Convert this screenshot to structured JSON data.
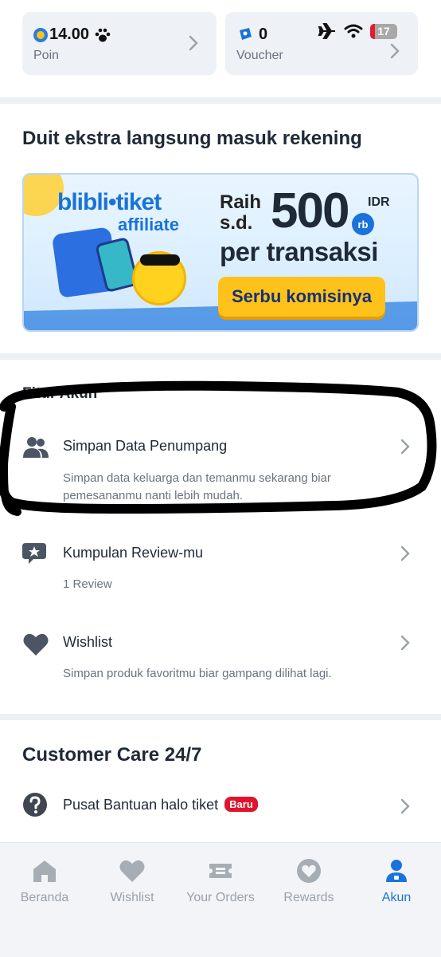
{
  "points": {
    "value": "14.00",
    "label": "Poin"
  },
  "voucher": {
    "value": "0",
    "label": "Voucher"
  },
  "status_bar": {
    "battery": "17",
    "icons": [
      "paw-icon",
      "airplane-icon",
      "wifi-icon",
      "battery-icon"
    ]
  },
  "affiliate": {
    "title": "Duit ekstra langsung masuk rekening",
    "banner": {
      "brand": "blibli•tiket",
      "sub": "affiliate",
      "raih": "Raih",
      "sd": "s.d.",
      "amount": "500",
      "currency": "IDR",
      "unit": "rb",
      "per": "per transaksi",
      "cta": "Serbu komisinya"
    }
  },
  "fitur": {
    "title": "Fitur Akun",
    "items": [
      {
        "title": "Simpan Data Penumpang",
        "desc": "Simpan data keluarga dan temanmu sekarang biar pemesananmu nanti lebih mudah.",
        "icon": "people-icon"
      },
      {
        "title": "Kumpulan Review-mu",
        "desc": "1 Review",
        "icon": "review-icon"
      },
      {
        "title": "Wishlist",
        "desc": "Simpan produk favoritmu biar gampang dilihat lagi.",
        "icon": "heart-icon"
      }
    ]
  },
  "customer_care": {
    "title": "Customer Care 24/7",
    "item": {
      "title": "Pusat Bantuan halo tiket",
      "badge": "Baru",
      "icon": "question-icon"
    }
  },
  "bottom_nav": {
    "items": [
      {
        "label": "Beranda",
        "icon": "home-icon"
      },
      {
        "label": "Wishlist",
        "icon": "heart-icon"
      },
      {
        "label": "Your Orders",
        "icon": "ticket-icon"
      },
      {
        "label": "Rewards",
        "icon": "rewards-icon"
      },
      {
        "label": "Akun",
        "icon": "account-icon",
        "active": true
      }
    ]
  },
  "colors": {
    "accent": "#1a73d9",
    "badge": "#e0142c",
    "cta": "#ffc21a"
  }
}
